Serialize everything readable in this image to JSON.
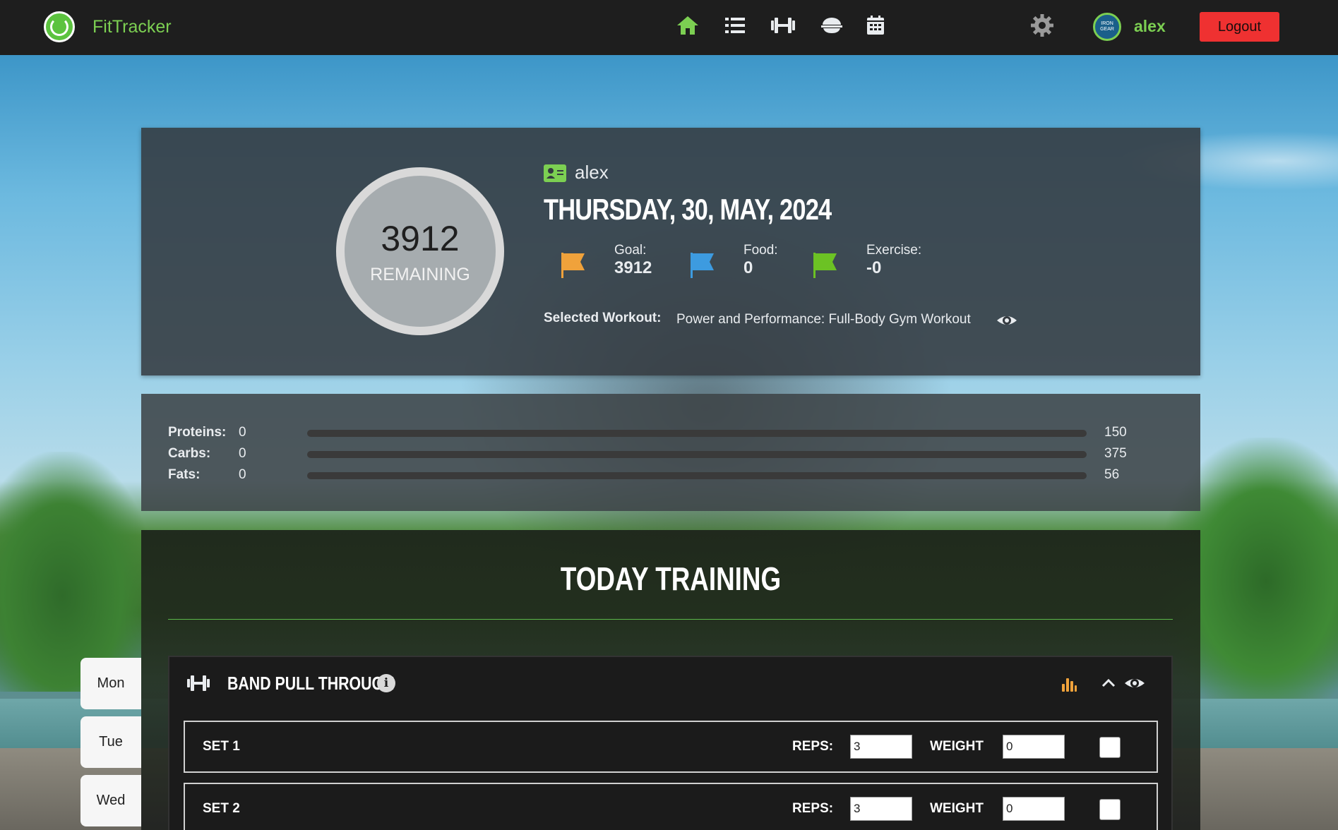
{
  "app": {
    "brand": "FitTracker",
    "avatar_text": "IRON\nGEAR",
    "username": "alex",
    "logout_label": "Logout",
    "nav_icons": [
      "home-icon",
      "list-icon",
      "dumbbell-icon",
      "food-bowl-icon",
      "calendar-icon"
    ],
    "accent_color": "#7ccf52",
    "logout_color": "#ef3131"
  },
  "summary": {
    "remaining_value": "3912",
    "remaining_label": "REMAINING",
    "profile_name": "alex",
    "date_title": "THURSDAY, 30, MAY, 2024",
    "stats": [
      {
        "label": "Goal:",
        "value": "3912",
        "flag_color": "#f0a23b"
      },
      {
        "label": "Food:",
        "value": "0",
        "flag_color": "#3d9be0"
      },
      {
        "label": "Exercise:",
        "value": "-0",
        "flag_color": "#6cc224"
      }
    ],
    "selected_workout_label": "Selected Workout:",
    "selected_workout_value": "Power and Performance: Full-Body Gym Workout"
  },
  "macros": [
    {
      "name": "Proteins:",
      "value": "0",
      "goal": "150",
      "fraction": 0
    },
    {
      "name": "Carbs:",
      "value": "0",
      "goal": "375",
      "fraction": 0
    },
    {
      "name": "Fats:",
      "value": "0",
      "goal": "56",
      "fraction": 0
    }
  ],
  "training": {
    "title": "TODAY TRAINING",
    "exercise_name": "BAND PULL THROUGH",
    "reps_label": "REPS:",
    "weight_label": "WEIGHT",
    "sets": [
      {
        "label": "SET 1",
        "reps": "3",
        "weight": "0"
      },
      {
        "label": "SET 2",
        "reps": "3",
        "weight": "0"
      }
    ]
  },
  "days": [
    "Mon",
    "Tue",
    "Wed"
  ]
}
